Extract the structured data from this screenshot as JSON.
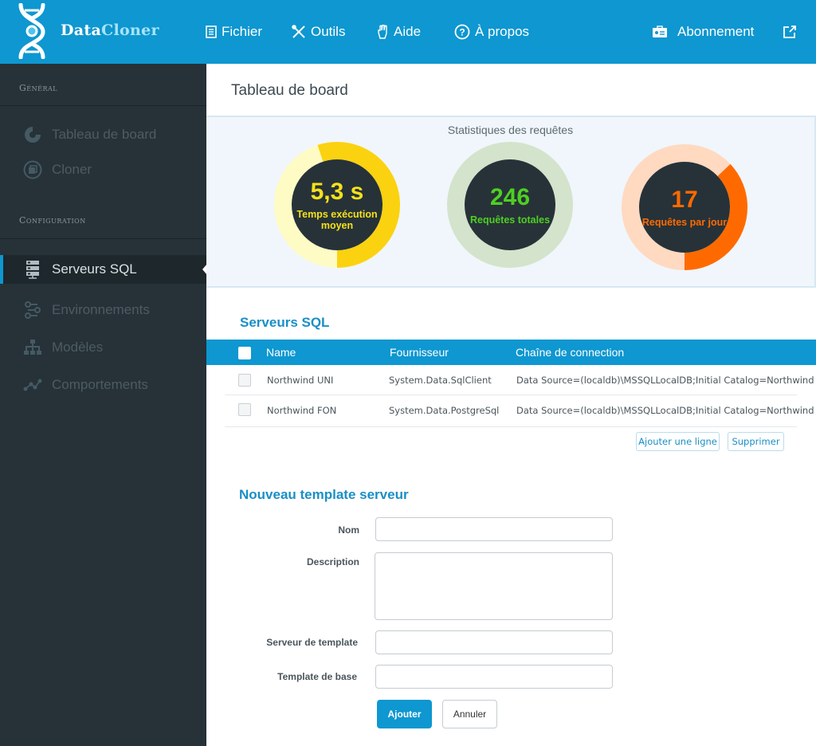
{
  "app": {
    "brand_part1": "Data",
    "brand_part2": "Cloner"
  },
  "nav": {
    "items": [
      {
        "label": "Fichier",
        "icon": "file-icon"
      },
      {
        "label": "Outils",
        "icon": "tools-icon"
      },
      {
        "label": "Aide",
        "icon": "hand-icon"
      },
      {
        "label": "À propos",
        "icon": "help-circle-icon"
      }
    ],
    "subscription": {
      "label": "Abonnement",
      "icon": "id-card-icon"
    },
    "export_icon": "share-icon"
  },
  "sidebar": {
    "section_general": "Général",
    "section_config": "Configuration",
    "general_items": [
      {
        "label": "Tableau de board",
        "icon": "dashboard-icon"
      },
      {
        "label": "Cloner",
        "icon": "clone-icon"
      }
    ],
    "config_items": [
      {
        "label": "Serveurs SQL",
        "icon": "server-icon",
        "active": true
      },
      {
        "label": "Environnements",
        "icon": "route-icon"
      },
      {
        "label": "Modèles",
        "icon": "sitemap-icon"
      },
      {
        "label": "Comportements",
        "icon": "chart-nodes-icon"
      }
    ]
  },
  "main": {
    "page_title": "Tableau de board",
    "stats": {
      "title": "Statistiques des requêtes",
      "gauges": [
        {
          "value": "5,3 s",
          "label": "Temps exécution moyen",
          "fraction": 0.55,
          "color": "#fbd210",
          "track": "#fffbc4",
          "text_color": "#f5e11a"
        },
        {
          "value": "246",
          "label": "Requêtes totales",
          "fraction": 0,
          "color": "#56c623",
          "track": "#d4e3cc",
          "text_color": "#4fcf22"
        },
        {
          "value": "17",
          "label": "Requêtes par jour",
          "fraction": 0.37,
          "color": "#ff6a00",
          "track": "#ffd9c0",
          "text_color": "#ff6a00"
        }
      ]
    },
    "servers": {
      "title": "Serveurs SQL",
      "columns": [
        "Name",
        "Fournisseur",
        "Chaîne de connection"
      ],
      "rows": [
        {
          "name": "Northwind UNI",
          "provider": "System.Data.SqlClient",
          "connection": "Data Source=(localdb)\\MSSQLLocalDB;Initial Catalog=Northwind"
        },
        {
          "name": "Northwind FON",
          "provider": "System.Data.PostgreSql",
          "connection": "Data Source=(localdb)\\MSSQLLocalDB;Initial Catalog=Northwind"
        }
      ],
      "add_row_label": "Ajouter une ligne",
      "delete_label": "Supprimer"
    },
    "form": {
      "title": "Nouveau template serveur",
      "name_label": "Nom",
      "name_value": "",
      "description_label": "Description",
      "description_value": "",
      "template_server_label": "Serveur de template",
      "template_server_value": "",
      "base_template_label": "Template de base",
      "base_template_value": "",
      "submit_label": "Ajouter",
      "cancel_label": "Annuler"
    }
  }
}
